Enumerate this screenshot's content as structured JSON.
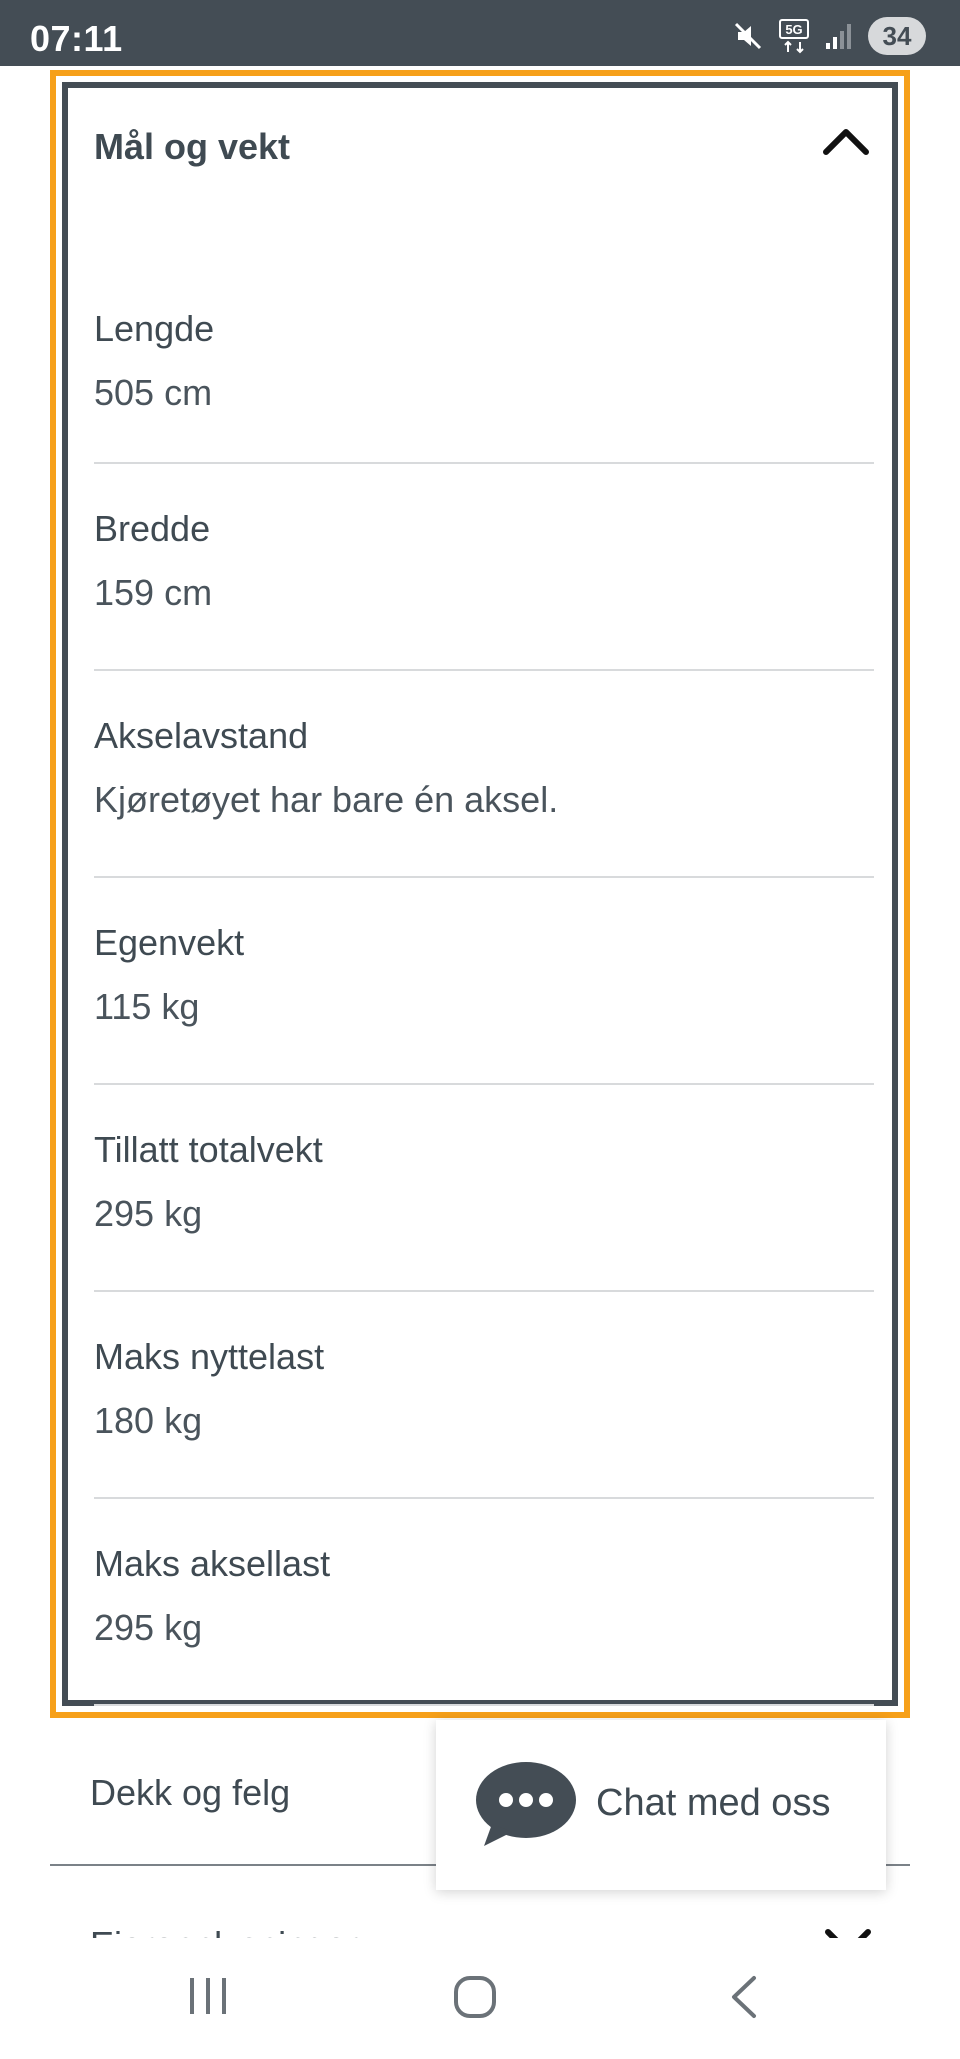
{
  "status_bar": {
    "time": "07:11",
    "battery_level": "34",
    "network": "5G",
    "icons": [
      "mute-icon",
      "5g-icon",
      "signal-icon",
      "battery-icon"
    ]
  },
  "section": {
    "title": "Mål og vekt",
    "expanded": true,
    "specs": [
      {
        "label": "Lengde",
        "value": "505 cm"
      },
      {
        "label": "Bredde",
        "value": "159 cm"
      },
      {
        "label": "Akselavstand",
        "value": "Kjøretøyet har bare én aksel."
      },
      {
        "label": "Egenvekt",
        "value": "115 kg"
      },
      {
        "label": "Tillatt totalvekt",
        "value": "295 kg"
      },
      {
        "label": "Maks nyttelast",
        "value": "180 kg"
      },
      {
        "label": "Maks aksellast",
        "value": "295 kg"
      }
    ]
  },
  "collapsed_sections": [
    {
      "title": "Dekk og felg"
    },
    {
      "title": "Eieropplysninger"
    }
  ],
  "chat": {
    "label": "Chat med oss"
  },
  "colors": {
    "focus_ring": "#f6a01a",
    "panel_border": "#444d55",
    "status_bar": "#444d55",
    "text": "#3f4a52"
  }
}
